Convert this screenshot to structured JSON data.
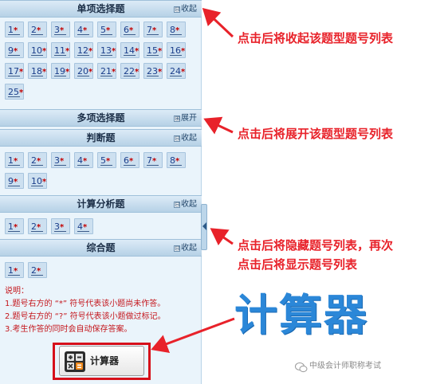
{
  "sections": [
    {
      "title": "单项选择题",
      "toggle_icon": "⊟",
      "toggle_label": "收起",
      "questions": [
        {
          "num": "1",
          "mark": "*"
        },
        {
          "num": "2",
          "mark": "*"
        },
        {
          "num": "3",
          "mark": "*"
        },
        {
          "num": "4",
          "mark": "*"
        },
        {
          "num": "5",
          "mark": "*"
        },
        {
          "num": "6",
          "mark": "*"
        },
        {
          "num": "7",
          "mark": "*"
        },
        {
          "num": "8",
          "mark": "*"
        },
        {
          "num": "9",
          "mark": "*"
        },
        {
          "num": "10",
          "mark": "*"
        },
        {
          "num": "11",
          "mark": "*"
        },
        {
          "num": "12",
          "mark": "*"
        },
        {
          "num": "13",
          "mark": "*"
        },
        {
          "num": "14",
          "mark": "*"
        },
        {
          "num": "15",
          "mark": "*"
        },
        {
          "num": "16",
          "mark": "*"
        },
        {
          "num": "17",
          "mark": "*"
        },
        {
          "num": "18",
          "mark": "*"
        },
        {
          "num": "19",
          "mark": "*"
        },
        {
          "num": "20",
          "mark": "*"
        },
        {
          "num": "21",
          "mark": "*"
        },
        {
          "num": "22",
          "mark": "*"
        },
        {
          "num": "23",
          "mark": "*"
        },
        {
          "num": "24",
          "mark": "*"
        },
        {
          "num": "25",
          "mark": "*"
        }
      ]
    },
    {
      "title": "多项选择题",
      "toggle_icon": "⊞",
      "toggle_label": "展开",
      "questions": []
    },
    {
      "title": "判断题",
      "toggle_icon": "⊟",
      "toggle_label": "收起",
      "questions": [
        {
          "num": "1",
          "mark": "*"
        },
        {
          "num": "2",
          "mark": "*"
        },
        {
          "num": "3",
          "mark": "*"
        },
        {
          "num": "4",
          "mark": "*"
        },
        {
          "num": "5",
          "mark": "*"
        },
        {
          "num": "6",
          "mark": "*"
        },
        {
          "num": "7",
          "mark": "*"
        },
        {
          "num": "8",
          "mark": "*"
        },
        {
          "num": "9",
          "mark": "*"
        },
        {
          "num": "10",
          "mark": "*"
        }
      ]
    },
    {
      "title": "计算分析题",
      "toggle_icon": "⊟",
      "toggle_label": "收起",
      "questions": [
        {
          "num": "1",
          "mark": "*"
        },
        {
          "num": "2",
          "mark": "*"
        },
        {
          "num": "3",
          "mark": "*"
        },
        {
          "num": "4",
          "mark": "*"
        }
      ]
    },
    {
      "title": "综合题",
      "toggle_icon": "⊟",
      "toggle_label": "收起",
      "questions": [
        {
          "num": "1",
          "mark": "*"
        },
        {
          "num": "2",
          "mark": "*"
        }
      ]
    }
  ],
  "notes": {
    "heading": "说明：",
    "lines": [
      "1.题号右方的 “*” 符号代表该小题尚未作答。",
      "2.题号右方的 “?” 符号代表该小题做过标记。",
      "3.考生作答的同时会自动保存答案。"
    ]
  },
  "calculator": {
    "label": "计算器",
    "icon": "calculator-icon"
  },
  "annotations": {
    "collapse": "点击后将收起该题型题号列表",
    "expand": "点击后将展开该题型题号列表",
    "hide_line1": "点击后将隐藏题号列表，再次",
    "hide_line2": "点击后将显示题号列表",
    "calculator": "计算器"
  },
  "watermark": "中级会计师职称考试",
  "colors": {
    "annotation_red": "#e8222a",
    "calculator_blue": "#2b87d8",
    "unanswered_mark": "#c40000",
    "highlight_frame": "#d6101a"
  }
}
